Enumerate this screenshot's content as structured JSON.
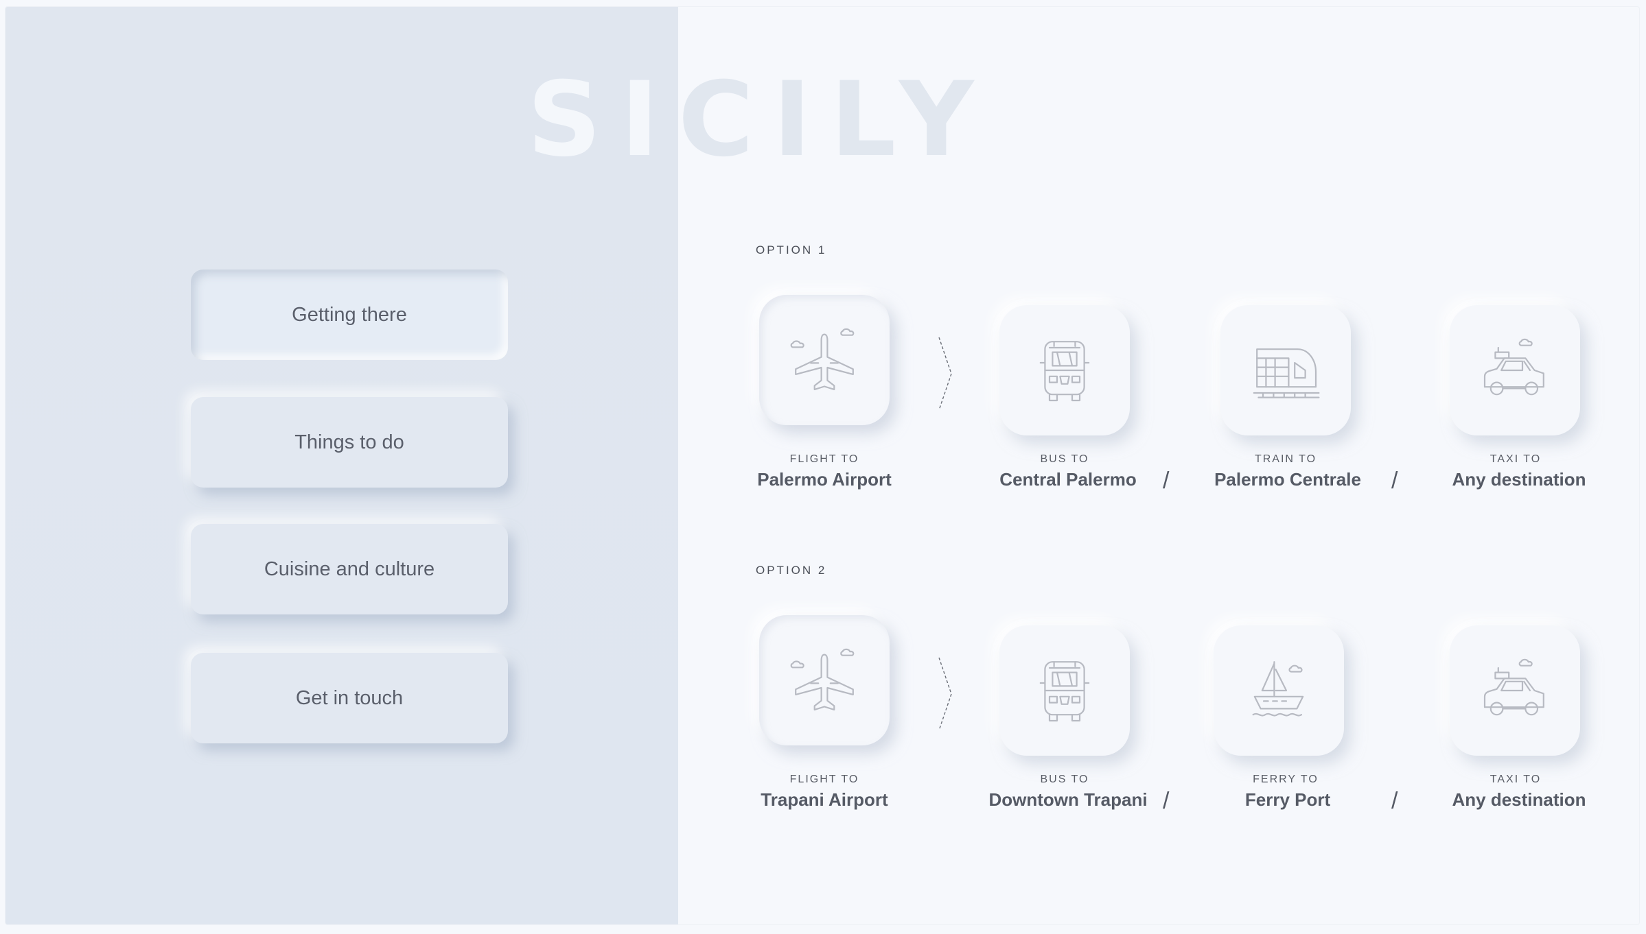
{
  "title": "SICILY",
  "nav": {
    "items": [
      {
        "label": "Getting there",
        "active": true
      },
      {
        "label": "Things to do"
      },
      {
        "label": "Cuisine and culture"
      },
      {
        "label": "Get in touch"
      }
    ]
  },
  "options": [
    {
      "label": "OPTION 1",
      "steps": [
        {
          "mode": "FLIGHT TO",
          "destination": "Palermo Airport",
          "icon": "airplane-icon"
        },
        {
          "mode": "BUS TO",
          "destination": "Central Palermo",
          "icon": "bus-icon"
        },
        {
          "mode": "TRAIN TO",
          "destination": "Palermo Centrale",
          "icon": "train-icon"
        },
        {
          "mode": "TAXI TO",
          "destination": "Any destination",
          "icon": "taxi-icon"
        }
      ]
    },
    {
      "label": "OPTION 2",
      "steps": [
        {
          "mode": "FLIGHT TO",
          "destination": "Trapani Airport",
          "icon": "airplane-icon"
        },
        {
          "mode": "BUS TO",
          "destination": "Downtown Trapani",
          "icon": "bus-icon"
        },
        {
          "mode": "FERRY TO",
          "destination": "Ferry Port",
          "icon": "ferry-icon"
        },
        {
          "mode": "TAXI TO",
          "destination": "Any destination",
          "icon": "taxi-icon"
        }
      ]
    }
  ],
  "separator": "/",
  "colors": {
    "panel": "#e0e6ef",
    "background": "#f6f8fc",
    "text": "#555a65",
    "icon": "#b7bac2"
  }
}
